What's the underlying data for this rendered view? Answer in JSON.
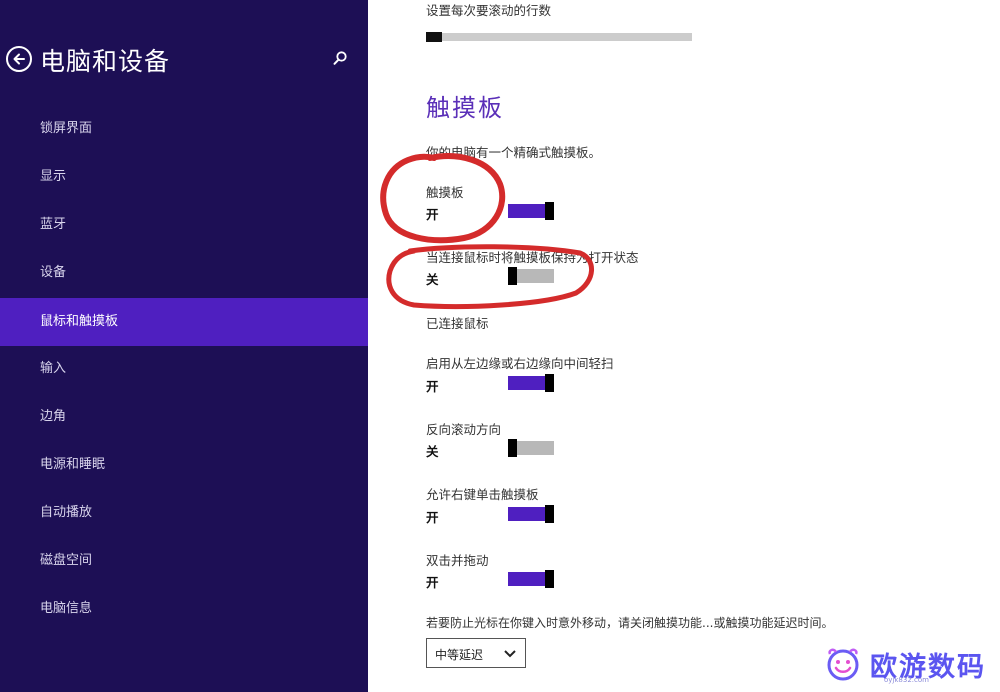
{
  "sidebar": {
    "title": "电脑和设备",
    "back_icon": "back-arrow-icon",
    "search_icon": "search-icon",
    "items": [
      {
        "label": "锁屏界面",
        "active": false
      },
      {
        "label": "显示",
        "active": false
      },
      {
        "label": "蓝牙",
        "active": false
      },
      {
        "label": "设备",
        "active": false
      },
      {
        "label": "鼠标和触摸板",
        "active": true
      },
      {
        "label": "输入",
        "active": false
      },
      {
        "label": "边角",
        "active": false
      },
      {
        "label": "电源和睡眠",
        "active": false
      },
      {
        "label": "自动播放",
        "active": false
      },
      {
        "label": "磁盘空间",
        "active": false
      },
      {
        "label": "电脑信息",
        "active": false
      }
    ]
  },
  "main": {
    "scroll_lines_label": "设置每次要滚动的行数",
    "scroll_lines_level": 0.06,
    "section_title": "触摸板",
    "precision_note": "你的电脑有一个精确式触摸板。",
    "settings": [
      {
        "label": "触摸板",
        "state": "开",
        "on": true
      },
      {
        "label": "当连接鼠标时将触摸板保持为打开状态",
        "state": "关",
        "on": false
      },
      {
        "label": "已连接鼠标",
        "state": "",
        "on": null
      },
      {
        "label": "启用从左边缘或右边缘向中间轻扫",
        "state": "开",
        "on": true
      },
      {
        "label": "反向滚动方向",
        "state": "关",
        "on": false
      },
      {
        "label": "允许右键单击触摸板",
        "state": "开",
        "on": true
      },
      {
        "label": "双击并拖动",
        "state": "开",
        "on": true
      }
    ],
    "delay_label": "若要防止光标在你键入时意外移动，请关闭触摸功能...或触摸功能延迟时间。",
    "delay_value": "中等延迟",
    "dropdown_icon": "chevron-down-icon"
  },
  "watermark": {
    "text": "欧游数码",
    "url": "oyjk832.com",
    "logo_icon": "smiley-logo-icon"
  },
  "colors": {
    "sidebar_bg": "#1d0f55",
    "accent": "#4f1fc0",
    "annotation": "#d42b2b"
  }
}
